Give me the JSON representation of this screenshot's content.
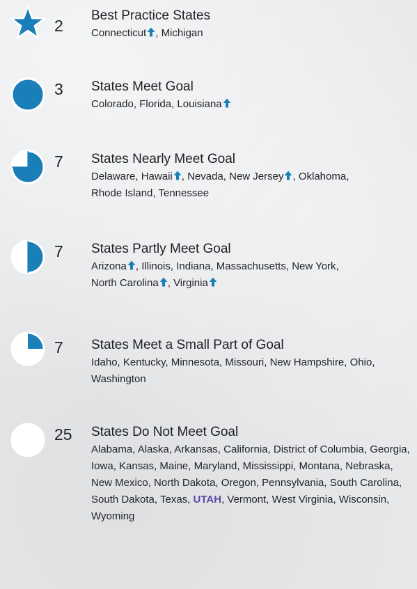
{
  "colors": {
    "accent": "#1a7fb8",
    "highlight": "#5b4aa5",
    "text": "#1f2326"
  },
  "groups": [
    {
      "icon": "star-icon",
      "fill": 1.0,
      "count": "2",
      "title": "Best Practice States",
      "states": [
        {
          "name": "Connecticut",
          "arrow": true
        },
        {
          "name": "Michigan"
        }
      ]
    },
    {
      "icon": "full-circle-icon",
      "fill": 1.0,
      "count": "3",
      "title": "States Meet Goal",
      "states": [
        {
          "name": "Colorado"
        },
        {
          "name": "Florida"
        },
        {
          "name": "Louisiana",
          "arrow": true
        }
      ]
    },
    {
      "icon": "three-quarter-circle-icon",
      "fill": 0.75,
      "count": "7",
      "title": "States Nearly Meet Goal",
      "states": [
        {
          "name": "Delaware"
        },
        {
          "name": "Hawaii",
          "arrow": true
        },
        {
          "name": "Nevada"
        },
        {
          "name": "New Jersey",
          "arrow": true
        },
        {
          "name": "Oklahoma"
        },
        {
          "name": "Rhode Island"
        },
        {
          "name": "Tennessee"
        }
      ]
    },
    {
      "icon": "half-circle-icon",
      "fill": 0.5,
      "count": "7",
      "title": "States Partly Meet Goal",
      "states": [
        {
          "name": "Arizona",
          "arrow": true
        },
        {
          "name": "Illinois"
        },
        {
          "name": "Indiana"
        },
        {
          "name": "Massachusetts"
        },
        {
          "name": "New York"
        },
        {
          "name": "North Carolina",
          "arrow": true
        },
        {
          "name": "Virginia",
          "arrow": true
        }
      ]
    },
    {
      "icon": "quarter-circle-icon",
      "fill": 0.25,
      "count": "7",
      "title": "States Meet a Small Part of Goal",
      "states": [
        {
          "name": "Idaho"
        },
        {
          "name": "Kentucky"
        },
        {
          "name": "Minnesota"
        },
        {
          "name": "Missouri"
        },
        {
          "name": "New Hampshire"
        },
        {
          "name": "Ohio"
        },
        {
          "name": "Washington"
        }
      ]
    },
    {
      "icon": "empty-circle-icon",
      "fill": 0.0,
      "count": "25",
      "title": "States Do Not Meet Goal",
      "states": [
        {
          "name": "Alabama"
        },
        {
          "name": "Alaska"
        },
        {
          "name": "Arkansas"
        },
        {
          "name": "California"
        },
        {
          "name": "District of Columbia"
        },
        {
          "name": "Georgia"
        },
        {
          "name": "Iowa"
        },
        {
          "name": "Kansas"
        },
        {
          "name": "Maine"
        },
        {
          "name": "Maryland"
        },
        {
          "name": "Mississippi"
        },
        {
          "name": "Montana"
        },
        {
          "name": "Nebraska"
        },
        {
          "name": "New Mexico"
        },
        {
          "name": "North Dakota"
        },
        {
          "name": "Oregon"
        },
        {
          "name": "Pennsylvania"
        },
        {
          "name": "South Carolina"
        },
        {
          "name": "South Dakota"
        },
        {
          "name": "Texas"
        },
        {
          "name": "UTAH",
          "highlight": true
        },
        {
          "name": "Vermont"
        },
        {
          "name": "West Virginia"
        },
        {
          "name": "Wisconsin"
        },
        {
          "name": "Wyoming"
        }
      ]
    }
  ]
}
